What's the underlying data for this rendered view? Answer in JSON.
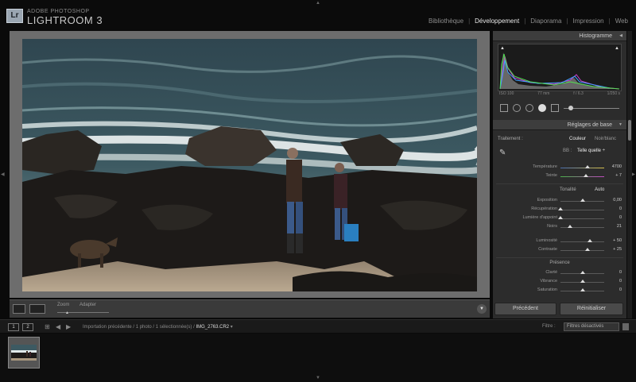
{
  "app": {
    "brand_small": "ADOBE PHOTOSHOP",
    "brand_big": "LIGHTROOM 3",
    "logo": "Lr"
  },
  "modules": [
    {
      "label": "Bibliothèque",
      "active": false
    },
    {
      "label": "Développement",
      "active": true
    },
    {
      "label": "Diaporama",
      "active": false
    },
    {
      "label": "Impression",
      "active": false
    },
    {
      "label": "Web",
      "active": false
    }
  ],
  "toolbar": {
    "zoom_label": "Zoom",
    "zoom_value": "Adapter"
  },
  "right_panel": {
    "histogram_title": "Histogramme",
    "exif": {
      "iso": "ISO 100",
      "focal": "77 mm",
      "aperture": "f / 6.3",
      "shutter": "1/250 s"
    },
    "basic_title": "Réglages de base",
    "treatment_label": "Traitement :",
    "treatment_color": "Couleur",
    "treatment_bw": "Noir/blanc",
    "wb_label": "BB :",
    "wb_value": "Telle quelle ÷",
    "temperature": {
      "label": "Température",
      "value": "4700",
      "pos": 0.62
    },
    "tint": {
      "label": "Teinte",
      "value": "+ 7",
      "pos": 0.58
    },
    "tone_label": "Tonalité",
    "auto_label": "Auto",
    "exposure": {
      "label": "Exposition",
      "value": "0,00",
      "pos": 0.5
    },
    "recovery": {
      "label": "Récupération",
      "value": "0",
      "pos": 0.0
    },
    "fill_light": {
      "label": "Lumière d'appoint",
      "value": "0",
      "pos": 0.0
    },
    "blacks": {
      "label": "Noirs",
      "value": "21",
      "pos": 0.21
    },
    "brightness": {
      "label": "Luminosité",
      "value": "+ 50",
      "pos": 0.67
    },
    "contrast": {
      "label": "Contraste",
      "value": "+ 25",
      "pos": 0.62
    },
    "presence_label": "Présence",
    "clarity": {
      "label": "Clarté",
      "value": "0",
      "pos": 0.5
    },
    "vibrance": {
      "label": "Vibrance",
      "value": "0",
      "pos": 0.5
    },
    "saturation": {
      "label": "Saturation",
      "value": "0",
      "pos": 0.5
    },
    "previous_button": "Précédent",
    "reset_button": "Réinitialiser"
  },
  "filmstrip": {
    "view1": "1",
    "view2": "2",
    "path_prefix": "Importation précédente / 1 photo / 1 sélectionnée(s) /",
    "filename": "IMG_2763.CR2",
    "filter_label": "Filtre :",
    "filter_value": "Filtres désactivés"
  },
  "colors": {
    "active_module": "#e8e8e8",
    "panel_bg": "#2c2c2c",
    "canvas_bg": "#6d6d6d"
  }
}
